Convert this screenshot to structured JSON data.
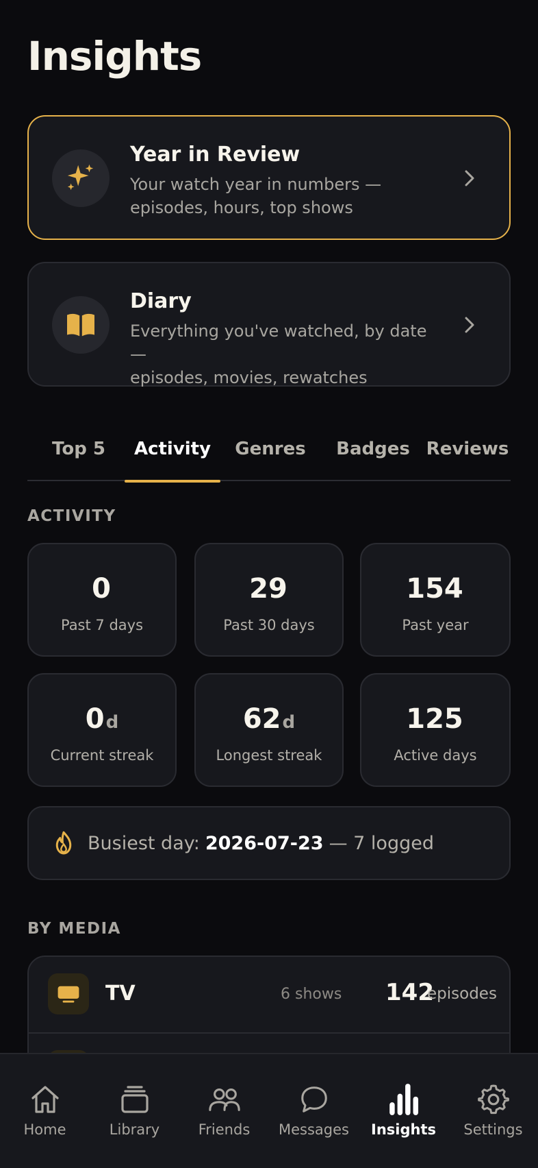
{
  "page": {
    "title": "Insights"
  },
  "cards": {
    "year_review": {
      "title": "Year in Review",
      "desc_line1": "Your watch year in numbers —",
      "desc_line2": "episodes, hours, top shows",
      "icon": "sparkles-icon"
    },
    "diary": {
      "title": "Diary",
      "desc_line1": "Everything you've watched, by date —",
      "desc_line2": "episodes, movies, rewatches",
      "icon": "book-open-icon"
    }
  },
  "tabs": [
    "Top 5",
    "Activity",
    "Genres",
    "Badges",
    "Reviews"
  ],
  "active_tab": "Activity",
  "activity": {
    "heading": "ACTIVITY",
    "stats": [
      {
        "value": "0",
        "unit": "",
        "label": "Past 7 days"
      },
      {
        "value": "29",
        "unit": "",
        "label": "Past 30 days"
      },
      {
        "value": "154",
        "unit": "",
        "label": "Past year"
      },
      {
        "value": "0",
        "unit": "d",
        "label": "Current streak"
      },
      {
        "value": "62",
        "unit": "d",
        "label": "Longest streak"
      },
      {
        "value": "125",
        "unit": "",
        "label": "Active days"
      }
    ],
    "busiest": {
      "prefix": "Busiest day:",
      "date": "2026-07-23",
      "suffix": "— 7 logged",
      "icon": "flame-icon"
    }
  },
  "by_media": {
    "heading": "BY MEDIA",
    "rows": [
      {
        "name": "TV",
        "count_label": "6 shows",
        "value": "142",
        "unit": "episodes",
        "icon": "tv-icon"
      }
    ]
  },
  "bottom_nav": {
    "items": [
      {
        "label": "Home",
        "icon": "home-icon"
      },
      {
        "label": "Library",
        "icon": "library-icon"
      },
      {
        "label": "Friends",
        "icon": "friends-icon"
      },
      {
        "label": "Messages",
        "icon": "messages-icon"
      },
      {
        "label": "Insights",
        "icon": "insights-icon"
      },
      {
        "label": "Settings",
        "icon": "settings-icon"
      }
    ],
    "active": "Insights"
  },
  "colors": {
    "background": "#0b0b0e",
    "card": "#17181d",
    "accent": "#e6b24a",
    "text_primary": "#f7f4ec",
    "text_secondary": "#a9a6a0"
  }
}
